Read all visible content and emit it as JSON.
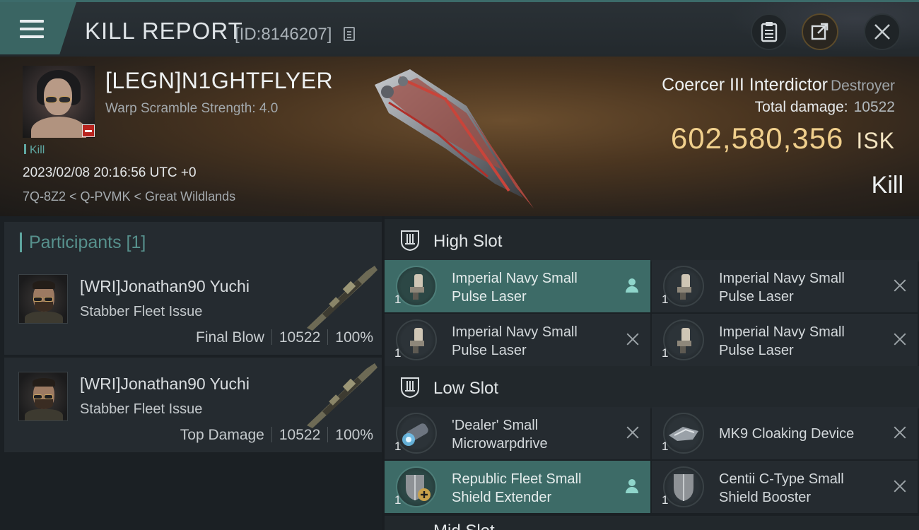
{
  "header": {
    "title": "KILL REPORT",
    "report_id": "[ID:8146207]"
  },
  "victim": {
    "name": "[LEGN]N1GHTFLYER",
    "warp_scramble": "Warp Scramble Strength: 4.0",
    "tag": "Kill",
    "timestamp": "2023/02/08 20:16:56 UTC +0",
    "location": "7Q-8Z2 < Q-PVMK < Great Wildlands",
    "ship_name": "Coercer III Interdictor",
    "ship_class": "Destroyer",
    "total_damage_label": "Total damage:",
    "total_damage_value": "10522",
    "isk_value": "602,580,356",
    "isk_unit": "ISK",
    "result": "Kill"
  },
  "participants": {
    "title": "Participants [1]",
    "rows": [
      {
        "name": "[WRI]Jonathan90 Yuchi",
        "ship": "Stabber Fleet Issue",
        "role": "Final Blow",
        "damage": "10522",
        "percent": "100%"
      },
      {
        "name": "[WRI]Jonathan90 Yuchi",
        "ship": "Stabber Fleet Issue",
        "role": "Top Damage",
        "damage": "10522",
        "percent": "100%"
      }
    ]
  },
  "fitting": {
    "high_slot": {
      "title": "High Slot",
      "modules": [
        {
          "name": "Imperial Navy Small Pulse Laser",
          "qty": "1",
          "status": "dropped"
        },
        {
          "name": "Imperial Navy Small Pulse Laser",
          "qty": "1",
          "status": "destroyed"
        },
        {
          "name": "Imperial Navy Small Pulse Laser",
          "qty": "1",
          "status": "destroyed"
        },
        {
          "name": "Imperial Navy Small Pulse Laser",
          "qty": "1",
          "status": "destroyed"
        }
      ]
    },
    "low_slot": {
      "title": "Low Slot",
      "modules": [
        {
          "name": "'Dealer' Small Microwarpdrive",
          "qty": "1",
          "status": "destroyed"
        },
        {
          "name": "MK9 Cloaking Device",
          "qty": "1",
          "status": "destroyed"
        },
        {
          "name": "Republic Fleet Small Shield Extender",
          "qty": "1",
          "status": "dropped"
        },
        {
          "name": "Centii C-Type Small Shield Booster",
          "qty": "1",
          "status": "destroyed"
        }
      ]
    },
    "mid_slot": {
      "title": "Mid Slot"
    }
  },
  "colors": {
    "accent_teal": "#3d6b67",
    "isk_gold": "#f0cf8c",
    "kill_tag": "#5fa7a2",
    "loss_badge": "#b8241f"
  },
  "icons": [
    "menu-icon",
    "copy-icon",
    "clipboard-icon",
    "share-icon",
    "close-icon",
    "slot-icon",
    "person-icon",
    "x-icon"
  ]
}
